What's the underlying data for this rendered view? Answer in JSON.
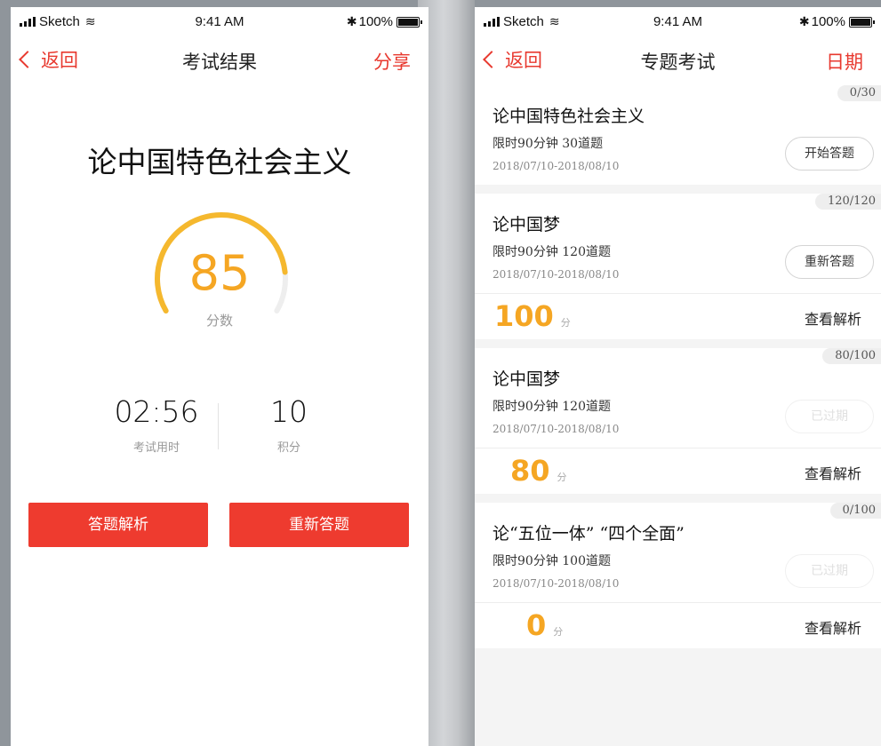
{
  "status": {
    "carrier": "Sketch",
    "time": "9:41 AM",
    "battery": "100%"
  },
  "left": {
    "nav": {
      "back": "返回",
      "title": "考试结果",
      "action": "分享"
    },
    "exam_title": "论中国特色社会主义",
    "score": {
      "value": "85",
      "label": "分数",
      "progress": 0.85
    },
    "stats": [
      {
        "value": "02:56",
        "label": "考试用时"
      },
      {
        "value": "10",
        "label": "积分"
      }
    ],
    "buttons": {
      "analysis": "答题解析",
      "retake": "重新答题"
    }
  },
  "right": {
    "nav": {
      "back": "返回",
      "title": "专题考试",
      "action": "日期"
    },
    "cards": [
      {
        "progress": "0/30",
        "title": "论中国特色社会主义",
        "meta": "限时90分钟 30道题",
        "date": "2018/07/10-2018/08/10",
        "button": "开始答题",
        "button_disabled": false,
        "score": null,
        "score_unit": null,
        "link": null
      },
      {
        "progress": "120/120",
        "title": "论中国梦",
        "meta": "限时90分钟 120道题",
        "date": "2018/07/10-2018/08/10",
        "button": "重新答题",
        "button_disabled": false,
        "score": "100",
        "score_unit": "分",
        "link": "查看解析"
      },
      {
        "progress": "80/100",
        "title": "论中国梦",
        "meta": "限时90分钟 120道题",
        "date": "2018/07/10-2018/08/10",
        "button": "已过期",
        "button_disabled": true,
        "score": "80",
        "score_unit": "分",
        "link": "查看解析"
      },
      {
        "progress": "0/100",
        "title": "论“五位一体” “四个全面”",
        "meta": "限时90分钟 100道题",
        "date": "2018/07/10-2018/08/10",
        "button": "已过期",
        "button_disabled": true,
        "score": "0",
        "score_unit": "分",
        "link": "查看解析"
      }
    ]
  },
  "colors": {
    "accent_red": "#ee3b2f",
    "score_orange": "#f5a623",
    "gauge_track": "#eeeeee"
  }
}
